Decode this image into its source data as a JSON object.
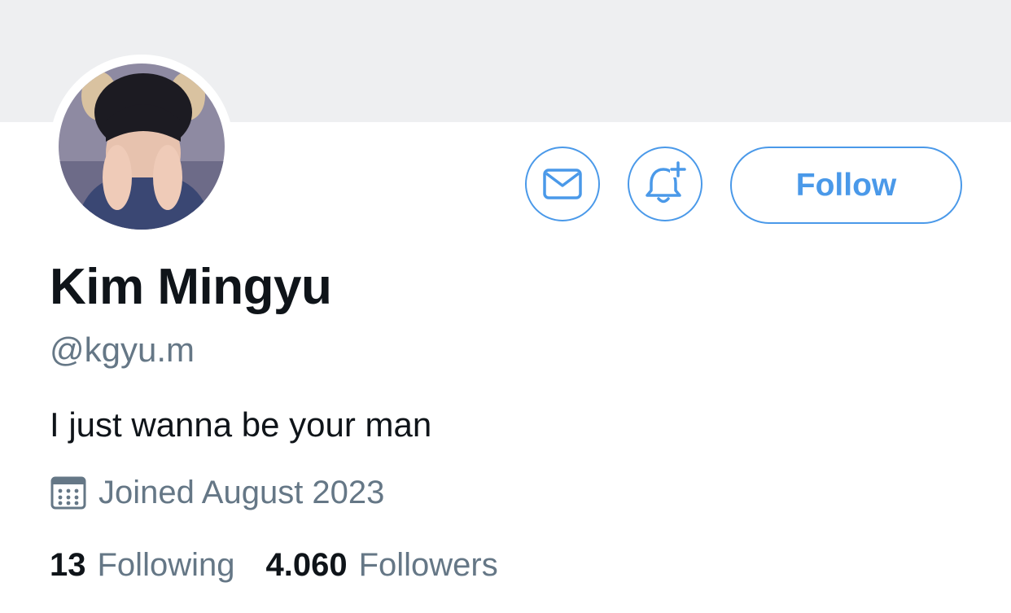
{
  "profile": {
    "name": "Kim Mingyu",
    "handle": "@kgyu.m",
    "bio": "I just wanna be your man",
    "joined": "Joined August 2023",
    "avatar": "profile-photo"
  },
  "actions": {
    "message_icon": "envelope-icon",
    "notify_icon": "bell-plus-icon",
    "follow_label": "Follow"
  },
  "stats": {
    "following_count": "13",
    "following_label": "Following",
    "followers_count": "4.060",
    "followers_label": "Followers"
  },
  "colors": {
    "accent": "#4a99e9",
    "banner": "#eeeff1",
    "text_primary": "#0f1419",
    "text_secondary": "#657786"
  }
}
